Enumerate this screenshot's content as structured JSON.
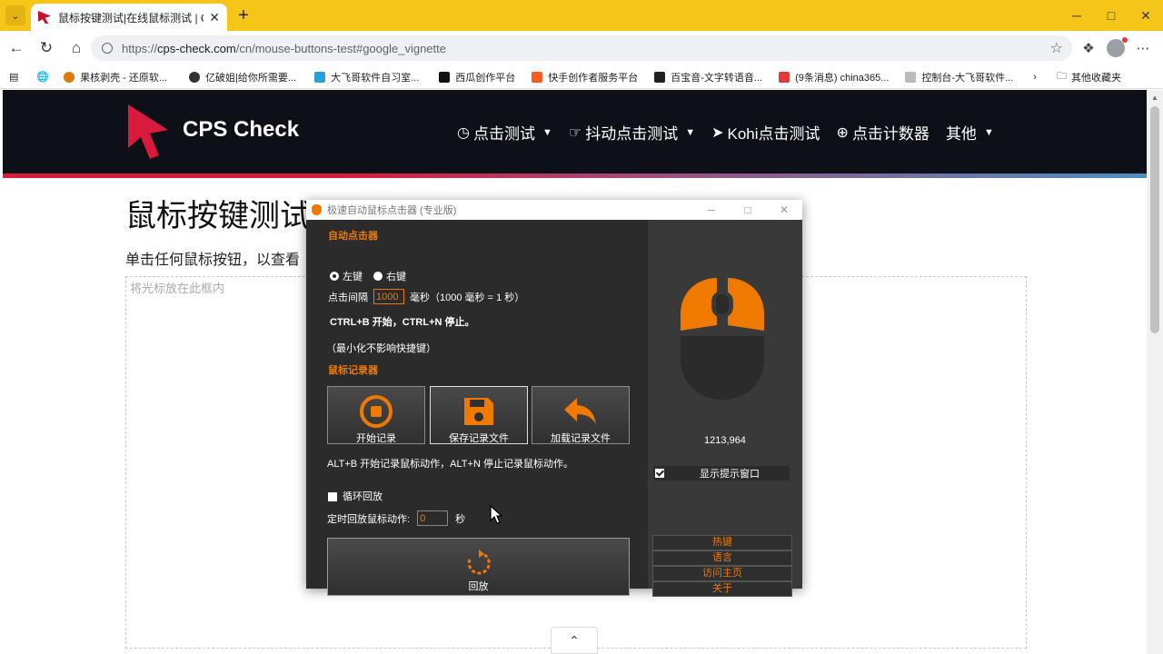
{
  "browser": {
    "tab_title": "鼠标按键测试|在线鼠标测试 | CPS",
    "url_prefix": "https://",
    "url_host": "cps-check.com",
    "url_path": "/cn/mouse-buttons-test#google_vignette",
    "bookmarks": [
      {
        "label": "果核剥壳 - 还原软...",
        "color": "#e07b00"
      },
      {
        "label": "亿破姐|给你所需要...",
        "color": "#333333"
      },
      {
        "label": "大飞哥软件自习室...",
        "color": "#2aa0d8"
      },
      {
        "label": "西瓜创作平台",
        "color": "#111111"
      },
      {
        "label": "快手创作者服务平台",
        "color": "#ff5a1f"
      },
      {
        "label": "百宝音-文字转语音...",
        "color": "#222222"
      },
      {
        "label": "(9条消息) china365...",
        "color": "#e53935"
      },
      {
        "label": "控制台-大飞哥软件...",
        "color": "#888888"
      }
    ],
    "other_bookmarks": "其他收藏夹"
  },
  "site": {
    "logo": "CPS Check",
    "nav": [
      {
        "label": "点击测试",
        "icon": "clock-icon",
        "caret": true
      },
      {
        "label": "抖动点击测试",
        "icon": "jitter-icon",
        "caret": true
      },
      {
        "label": "Kohi点击测试",
        "icon": "cursor-icon",
        "caret": false
      },
      {
        "label": "点击计数器",
        "icon": "plus-circle-icon",
        "caret": false
      },
      {
        "label": "其他",
        "icon": "",
        "caret": true
      }
    ],
    "page_title": "鼠标按键测试",
    "page_desc": "单击任何鼠标按钮，以查看",
    "area_hint": "将光标放在此框内"
  },
  "app": {
    "title": "极速自动鼠标点击器 (专业版)",
    "section_auto": "自动点击器",
    "left_key": "左键",
    "right_key": "右键",
    "interval_label": "点击间隔",
    "interval_value": "1000",
    "interval_unit": "毫秒（1000 毫秒 = 1 秒）",
    "hotkey_text": "CTRL+B 开始，CTRL+N 停止。",
    "minimize_note": "（最小化不影响快捷键）",
    "section_recorder": "鼠标记录器",
    "btn_start_record": "开始记录",
    "btn_save_record": "保存记录文件",
    "btn_load_record": "加载记录文件",
    "record_hotkey_text": "ALT+B 开始记录鼠标动作，ALT+N 停止记录鼠标动作。",
    "loop_label": "循环回放",
    "timer_label": "定时回放鼠标动作:",
    "timer_value": "0",
    "timer_unit": "秒",
    "btn_replay": "回放",
    "coords": "1213,964",
    "show_tip_label": "显示提示窗口",
    "links": [
      "热键",
      "语言",
      "访问主页",
      "关于"
    ],
    "accent_color": "#f07a00"
  }
}
